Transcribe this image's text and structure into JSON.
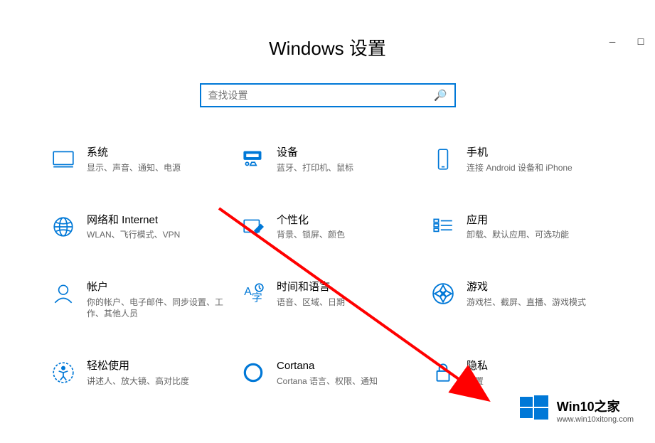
{
  "header": {
    "title": "Windows 设置"
  },
  "search": {
    "placeholder": "查找设置"
  },
  "items": [
    {
      "title": "系统",
      "desc": "显示、声音、通知、电源"
    },
    {
      "title": "设备",
      "desc": "蓝牙、打印机、鼠标"
    },
    {
      "title": "手机",
      "desc": "连接 Android 设备和 iPhone"
    },
    {
      "title": "网络和 Internet",
      "desc": "WLAN、飞行模式、VPN"
    },
    {
      "title": "个性化",
      "desc": "背景、锁屏、颜色"
    },
    {
      "title": "应用",
      "desc": "卸载、默认应用、可选功能"
    },
    {
      "title": "帐户",
      "desc": "你的帐户、电子邮件、同步设置、工作、其他人员"
    },
    {
      "title": "时间和语言",
      "desc": "语音、区域、日期"
    },
    {
      "title": "游戏",
      "desc": "游戏栏、截屏、直播、游戏模式"
    },
    {
      "title": "轻松使用",
      "desc": "讲述人、放大镜、高对比度"
    },
    {
      "title": "Cortana",
      "desc": "Cortana 语言、权限、通知"
    },
    {
      "title": "隐私",
      "desc": "位置"
    }
  ],
  "watermark": {
    "title": "Win10之家",
    "url": "www.win10xitong.com"
  }
}
